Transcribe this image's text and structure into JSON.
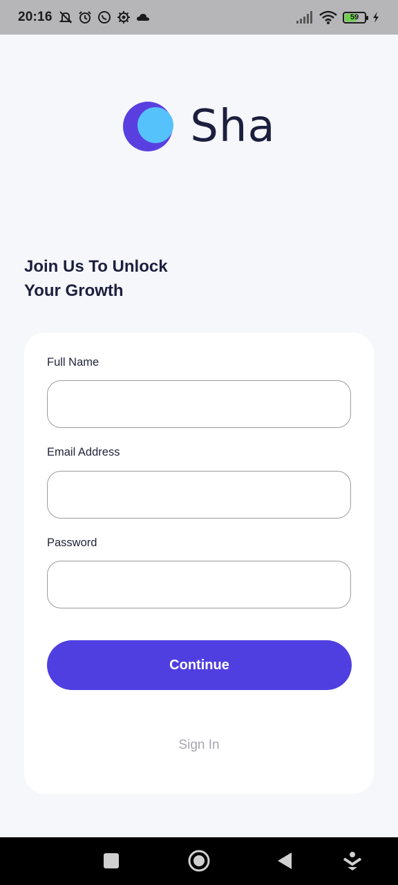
{
  "status_bar": {
    "time": "20:16",
    "battery_level": "59",
    "battery_percent": 59,
    "left_icons": [
      "muted-icon",
      "alarm-icon",
      "whatsapp-icon",
      "settings-gear-icon",
      "cloud-icon"
    ],
    "right_icons": [
      "signal-icon",
      "wifi-icon",
      "battery-icon",
      "charging-icon"
    ]
  },
  "logo": {
    "text": "Sha",
    "colors": {
      "outer": "#5a3fe0",
      "inner": "#56c2fb",
      "text": "#1c1f3d"
    }
  },
  "heading": {
    "line1": "Join Us To Unlock",
    "line2": "Your Growth"
  },
  "form": {
    "full_name": {
      "label": "Full Name",
      "value": "",
      "placeholder": ""
    },
    "email": {
      "label": "Email Address",
      "value": "",
      "placeholder": ""
    },
    "password": {
      "label": "Password",
      "value": "",
      "placeholder": ""
    },
    "continue_label": "Continue",
    "signin_label": "Sign In"
  },
  "colors": {
    "accent": "#4f3fe1",
    "background": "#f6f7fb",
    "card": "#ffffff",
    "muted_text": "#a6a7ae"
  },
  "nav_bar": {
    "buttons": [
      "recents-square-icon",
      "home-circle-icon",
      "back-triangle-icon",
      "assistant-icon"
    ]
  }
}
